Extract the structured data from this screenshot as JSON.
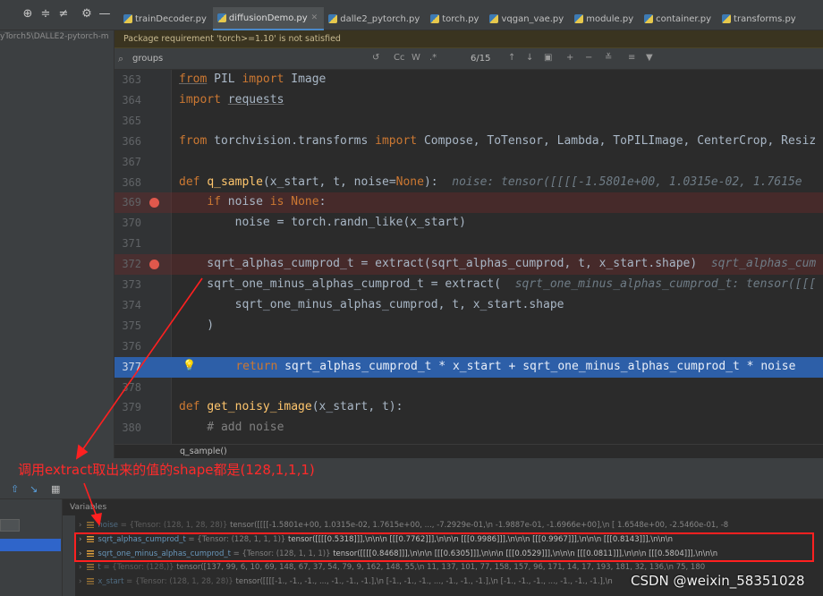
{
  "tabs": [
    {
      "label": "trainDecoder.py",
      "active": false
    },
    {
      "label": "diffusionDemo.py",
      "active": true
    },
    {
      "label": "dalle2_pytorch.py",
      "active": false
    },
    {
      "label": "torch.py",
      "active": false
    },
    {
      "label": "vqgan_vae.py",
      "active": false
    },
    {
      "label": "module.py",
      "active": false
    },
    {
      "label": "container.py",
      "active": false
    },
    {
      "label": "transforms.py",
      "active": false
    }
  ],
  "project_path": "yTorch5\\DALLE2-pytorch-m",
  "package_warning": "Package requirement 'torch>=1.10' is not satisfied",
  "search": {
    "query": "groups",
    "case_label": "Cc",
    "word_label": "W",
    "regex_label": ".*",
    "match_count": "6/15"
  },
  "editor": {
    "lines": [
      {
        "n": "363",
        "text": "from PIL import Image"
      },
      {
        "n": "364",
        "text": "import requests"
      },
      {
        "n": "365",
        "text": ""
      },
      {
        "n": "366",
        "text": "from torchvision.transforms import Compose, ToTensor, Lambda, ToPILImage, CenterCrop, Resiz"
      },
      {
        "n": "367",
        "text": ""
      },
      {
        "n": "368",
        "code": "def q_sample(x_start, t, noise=None):",
        "inline": "noise: tensor([[[[-1.5801e+00, 1.0315e-02, 1.7615e"
      },
      {
        "n": "369",
        "text": "    if noise is None:"
      },
      {
        "n": "370",
        "text": "        noise = torch.randn_like(x_start)"
      },
      {
        "n": "371",
        "text": ""
      },
      {
        "n": "372",
        "code": "    sqrt_alphas_cumprod_t = extract(sqrt_alphas_cumprod, t, x_start.shape)",
        "inline": "sqrt_alphas_cum"
      },
      {
        "n": "373",
        "code": "    sqrt_one_minus_alphas_cumprod_t = extract(",
        "inline": "sqrt_one_minus_alphas_cumprod_t: tensor([[["
      },
      {
        "n": "374",
        "text": "        sqrt_one_minus_alphas_cumprod, t, x_start.shape"
      },
      {
        "n": "375",
        "text": "    )"
      },
      {
        "n": "376",
        "text": ""
      },
      {
        "n": "377",
        "text": "    return sqrt_alphas_cumprod_t * x_start + sqrt_one_minus_alphas_cumprod_t * noise"
      },
      {
        "n": "378",
        "text": ""
      },
      {
        "n": "379",
        "text": "def get_noisy_image(x_start, t):"
      },
      {
        "n": "380",
        "text": "    # add noise"
      }
    ]
  },
  "breadcrumb": "q_sample()",
  "annotation": "调用extract取出来的值的shape都是(128,1,1,1)",
  "variables_header": "Variables",
  "variables": [
    {
      "name": "noise",
      "type": " = {Tensor: (128, 1, 28, 28)} ",
      "value": "tensor([[[[-1.5801e+00,  1.0315e-02,  1.7615e+00,  ..., -7.2929e-01,\\n          -1.9887e-01, -1.6966e+00],\\n         [ 1.6548e+00, -2.5460e-01, -8"
    },
    {
      "name": "sqrt_alphas_cumprod_t",
      "type": " = {Tensor: (128, 1, 1, 1)} ",
      "value": "tensor([[[[0.5318]]],\\n\\n\\n        [[[0.7762]]],\\n\\n\\n        [[[0.9986]]],\\n\\n\\n        [[[0.9967]]],\\n\\n\\n        [[[0.8143]]],\\n\\n\\n"
    },
    {
      "name": "sqrt_one_minus_alphas_cumprod_t",
      "type": " = {Tensor: (128, 1, 1, 1)} ",
      "value": "tensor([[[[0.8468]]],\\n\\n\\n        [[[0.6305]]],\\n\\n\\n        [[[0.0529]]],\\n\\n\\n        [[[0.0811]]],\\n\\n\\n        [[[0.5804]]],\\n\\n\\n"
    },
    {
      "name": "t",
      "type": " = {Tensor: (128,)} ",
      "value": "tensor([137,  99,   6,  10,  69, 148,  67,  37,  54,  79,   9, 162, 148,  55,\\n         11, 137, 101,  77, 158, 157,  96, 171,  14,  17, 193, 181,  32, 136,\\n         75, 180"
    },
    {
      "name": "x_start",
      "type": " = {Tensor: (128, 1, 28, 28)} ",
      "value": "tensor([[[[-1., -1., -1.,  ..., -1., -1., -1.],\\n          [-1., -1., -1.,  ..., -1., -1., -1.],\\n          [-1., -1., -1.,  ..., -1., -1., -1.],\\n"
    }
  ],
  "watermark": "CSDN @weixin_58351028"
}
